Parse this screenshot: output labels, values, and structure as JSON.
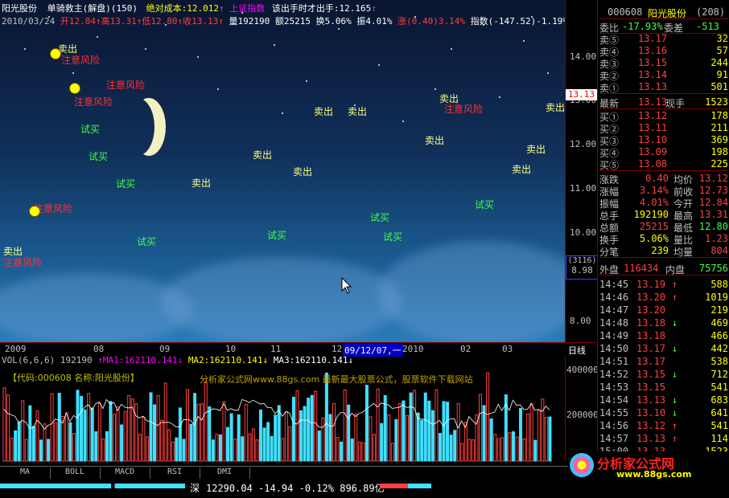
{
  "header": {
    "stock_name": "阳光股份",
    "formula": "单骑救主(解盘)",
    "formula_period": "(150)",
    "abs_cost": "绝对成本:12.012",
    "index_flag": "上证指数",
    "advice": "该出手时才出手:12.165",
    "date": "2010/03/24",
    "open": "开12.84",
    "high": "高13.31",
    "low": "低12.80",
    "close": "收13.13",
    "volume": "量192190",
    "amount": "额25215",
    "turnover": "换5.06%",
    "amplitude": "振4.01%",
    "change": "涨(0.40)3.14%",
    "index_change": "指数(-147.52)-1.19%"
  },
  "y_axis": [
    "14.00",
    "13.00",
    "12.00",
    "11.00",
    "10.00",
    "9.00",
    "8.00"
  ],
  "price_tag": "13.13",
  "crosshair_tag": [
    "(3116)",
    "8.98"
  ],
  "x_axis": [
    "2009",
    "08",
    "09",
    "10",
    "11",
    "12",
    "09/12/07,一",
    "2010",
    "02",
    "03"
  ],
  "period_label": "日线",
  "volume_header": {
    "vol": "VOL(6,6,6) 192190",
    "ma1": "MA1:162110.141",
    "ma2": "MA2:162110.141",
    "ma3": "MA3:162110.141"
  },
  "volume_axis": [
    "400000",
    "200000"
  ],
  "volume_banner": "【代码:000608 名称:阳光股份】",
  "watermark": "分析家公式网www.88gs.com 最新最大股票公式，股票软件下载网站",
  "annotations": {
    "sell": "卖出",
    "buy": "试买",
    "risk": "注意风险"
  },
  "tabs": [
    "MA",
    "BOLL",
    "MACD",
    "RSI",
    "DMI"
  ],
  "status": {
    "market": "深",
    "index_value": "12290.04",
    "index_delta": "-14.94",
    "index_pct": "-0.12%",
    "turnover": "896.89亿"
  },
  "quote": {
    "code": "000608",
    "name": "阳光股份",
    "num": "(208)",
    "weibi_label": "委比",
    "weibi_value": "-17.93%",
    "weicha_label": "委差",
    "weicha_value": "-513",
    "asks": [
      {
        "label": "卖⑤",
        "price": "13.17",
        "vol": "32"
      },
      {
        "label": "卖④",
        "price": "13.16",
        "vol": "57"
      },
      {
        "label": "卖③",
        "price": "13.15",
        "vol": "244"
      },
      {
        "label": "卖②",
        "price": "13.14",
        "vol": "91"
      },
      {
        "label": "卖①",
        "price": "13.13",
        "vol": "501"
      }
    ],
    "last_label": "最新",
    "last": "13.13",
    "hand_label": "现手",
    "hand": "1523",
    "bids": [
      {
        "label": "买①",
        "price": "13.12",
        "vol": "178"
      },
      {
        "label": "买②",
        "price": "13.11",
        "vol": "211"
      },
      {
        "label": "买③",
        "price": "13.10",
        "vol": "369"
      },
      {
        "label": "买④",
        "price": "13.09",
        "vol": "198"
      },
      {
        "label": "买⑤",
        "price": "13.08",
        "vol": "225"
      }
    ],
    "stats": [
      {
        "l1": "涨跌",
        "v1": "0.40",
        "l2": "均价",
        "v2": "13.12"
      },
      {
        "l1": "涨幅",
        "v1": "3.14%",
        "l2": "前收",
        "v2": "12.73"
      },
      {
        "l1": "振幅",
        "v1": "4.01%",
        "l2": "今开",
        "v2": "12.84"
      },
      {
        "l1": "总手",
        "v1": "192190",
        "l2": "最高",
        "v2": "13.31"
      },
      {
        "l1": "总额",
        "v1": "25215",
        "l2": "最低",
        "v2": "12.80"
      },
      {
        "l1": "换手",
        "v1": "5.06%",
        "l2": "量比",
        "v2": "1.23"
      },
      {
        "l1": "分笔",
        "v1": "239",
        "l2": "均量",
        "v2": "804"
      }
    ],
    "outer_label": "外盘",
    "outer": "116434",
    "inner_label": "内盘",
    "inner": "75756",
    "ticks": [
      {
        "t": "14:45",
        "p": "13.19",
        "d": "↑",
        "v": "588"
      },
      {
        "t": "14:46",
        "p": "13.20",
        "d": "↑",
        "v": "1019"
      },
      {
        "t": "14:47",
        "p": "13.20",
        "d": "",
        "v": "219"
      },
      {
        "t": "14:48",
        "p": "13.18",
        "d": "↓",
        "v": "469"
      },
      {
        "t": "14:49",
        "p": "13.18",
        "d": "",
        "v": "466"
      },
      {
        "t": "14:50",
        "p": "13.17",
        "d": "↓",
        "v": "442"
      },
      {
        "t": "14:51",
        "p": "13.17",
        "d": "",
        "v": "538"
      },
      {
        "t": "14:52",
        "p": "13.15",
        "d": "↓",
        "v": "712"
      },
      {
        "t": "14:53",
        "p": "13.15",
        "d": "",
        "v": "541"
      },
      {
        "t": "14:54",
        "p": "13.13",
        "d": "↓",
        "v": "683"
      },
      {
        "t": "14:55",
        "p": "13.10",
        "d": "↓",
        "v": "641"
      },
      {
        "t": "14:56",
        "p": "13.12",
        "d": "↑",
        "v": "541"
      },
      {
        "t": "14:57",
        "p": "13.13",
        "d": "↑",
        "v": "114"
      },
      {
        "t": "15:00",
        "p": "13.13",
        "d": "",
        "v": "1523"
      }
    ]
  },
  "logo_text": "分析家公式网",
  "logo_url": "www.88gs.com"
}
